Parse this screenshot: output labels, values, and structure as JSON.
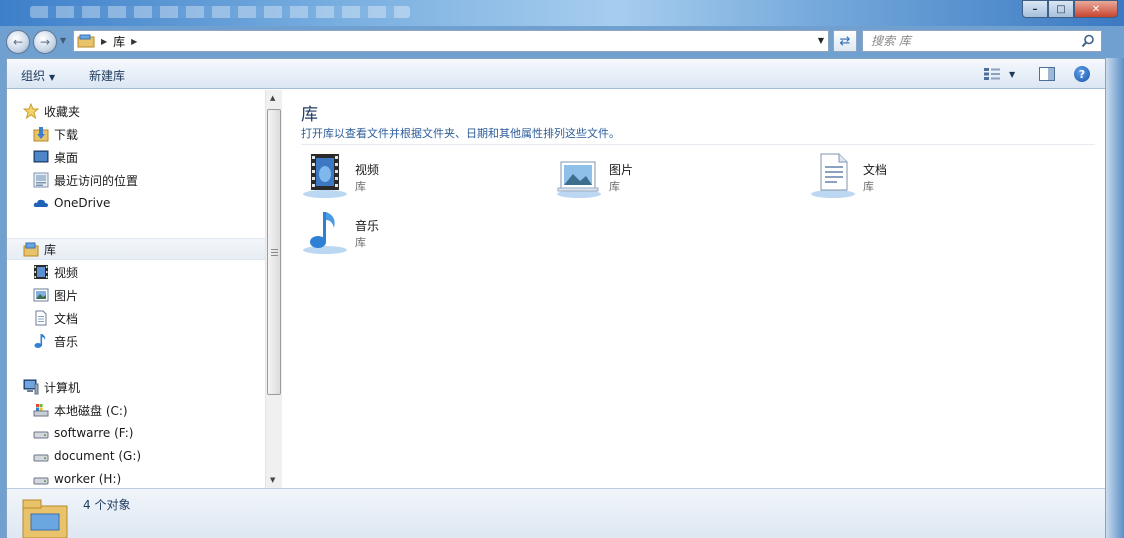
{
  "window": {
    "address": {
      "crumb": "库"
    },
    "search": {
      "placeholder": "搜索 库"
    }
  },
  "toolbar": {
    "organize_label": "组织",
    "new_library_label": "新建库"
  },
  "sidebar": {
    "favorites": {
      "label": "收藏夹",
      "items": [
        {
          "label": "下载",
          "icon": "download-folder-icon"
        },
        {
          "label": "桌面",
          "icon": "desktop-icon"
        },
        {
          "label": "最近访问的位置",
          "icon": "recent-places-icon"
        },
        {
          "label": "OneDrive",
          "icon": "onedrive-icon"
        }
      ]
    },
    "libraries": {
      "label": "库",
      "items": [
        {
          "label": "视频",
          "icon": "video-icon"
        },
        {
          "label": "图片",
          "icon": "pictures-icon"
        },
        {
          "label": "文档",
          "icon": "documents-icon"
        },
        {
          "label": "音乐",
          "icon": "music-icon"
        }
      ]
    },
    "computer": {
      "label": "计算机",
      "items": [
        {
          "label": "本地磁盘 (C:)",
          "icon": "system-drive-icon"
        },
        {
          "label": "softwarre (F:)",
          "icon": "drive-icon"
        },
        {
          "label": "document (G:)",
          "icon": "drive-icon"
        },
        {
          "label": "worker (H:)",
          "icon": "drive-icon"
        }
      ]
    }
  },
  "main": {
    "title": "库",
    "subtitle": "打开库以查看文件并根据文件夹、日期和其他属性排列这些文件。",
    "libraries": [
      {
        "name": "视频",
        "type": "库",
        "icon": "video-library-icon"
      },
      {
        "name": "图片",
        "type": "库",
        "icon": "pictures-library-icon"
      },
      {
        "name": "文档",
        "type": "库",
        "icon": "documents-library-icon"
      },
      {
        "name": "音乐",
        "type": "库",
        "icon": "music-library-icon"
      }
    ]
  },
  "details": {
    "count": "4 个对象"
  },
  "colors": {
    "accent": "#2c5d9a",
    "title_text": "#1e3a5f",
    "toolbar_top": "#f6f9fd",
    "toolbar_bottom": "#dbe6f3",
    "selected_row": "#e7edf4"
  }
}
